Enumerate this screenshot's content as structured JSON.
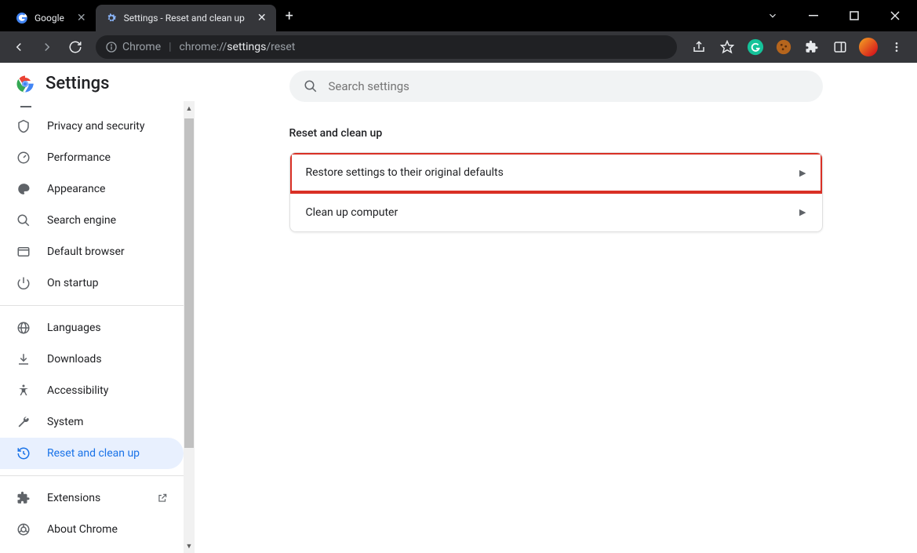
{
  "titlebar": {
    "tabs": [
      {
        "title": "Google",
        "active": false
      },
      {
        "title": "Settings - Reset and clean up",
        "active": true
      }
    ]
  },
  "toolbar": {
    "secure_label": "Chrome",
    "url_prefix": "chrome://",
    "url_mid": "settings",
    "url_suffix": "/reset"
  },
  "sidebar": {
    "title": "Settings",
    "items_top": [
      {
        "label": "Privacy and security"
      },
      {
        "label": "Performance"
      },
      {
        "label": "Appearance"
      },
      {
        "label": "Search engine"
      },
      {
        "label": "Default browser"
      },
      {
        "label": "On startup"
      }
    ],
    "items_mid": [
      {
        "label": "Languages"
      },
      {
        "label": "Downloads"
      },
      {
        "label": "Accessibility"
      },
      {
        "label": "System"
      },
      {
        "label": "Reset and clean up"
      }
    ],
    "items_bottom": [
      {
        "label": "Extensions"
      },
      {
        "label": "About Chrome"
      }
    ]
  },
  "main": {
    "search_placeholder": "Search settings",
    "section_title": "Reset and clean up",
    "rows": [
      {
        "label": "Restore settings to their original defaults"
      },
      {
        "label": "Clean up computer"
      }
    ]
  }
}
